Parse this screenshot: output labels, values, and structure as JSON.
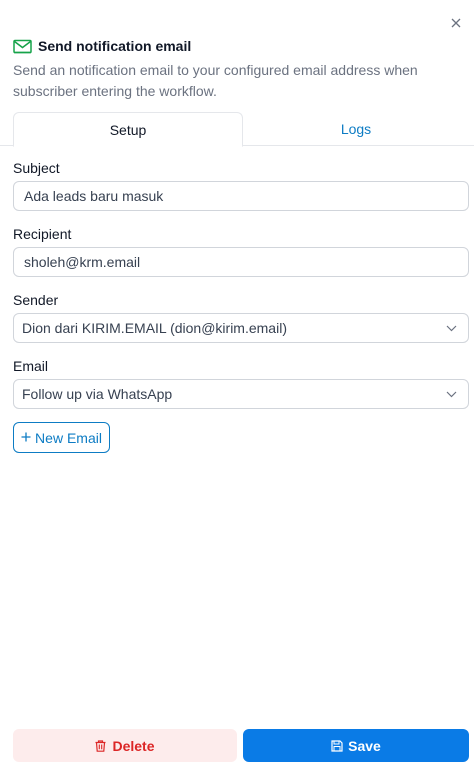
{
  "header": {
    "title": "Send notification email",
    "description": "Send an notification email to your configured email address when subscriber entering the workflow."
  },
  "tabs": [
    {
      "label": "Setup",
      "active": true
    },
    {
      "label": "Logs",
      "active": false
    }
  ],
  "form": {
    "subject": {
      "label": "Subject",
      "value": "Ada leads baru masuk"
    },
    "recipient": {
      "label": "Recipient",
      "value": "sholeh@krm.email"
    },
    "sender": {
      "label": "Sender",
      "value": "Dion dari KIRIM.EMAIL (dion@kirim.email)"
    },
    "email": {
      "label": "Email",
      "value": "Follow up via WhatsApp"
    }
  },
  "new_email_button": "New Email",
  "footer": {
    "delete_label": "Delete",
    "save_label": "Save"
  },
  "icons": {
    "close": "close-icon",
    "header": "envelope-icon",
    "chevron": "chevron-down-icon",
    "plus": "plus-icon",
    "delete": "trash-icon",
    "save": "floppy-disk-icon"
  },
  "colors": {
    "accent": "#0d7cc4",
    "save_bg": "#0a7be6",
    "delete_bg": "#fdecec",
    "delete_text": "#dc2626",
    "header_icon": "#16a34a"
  }
}
